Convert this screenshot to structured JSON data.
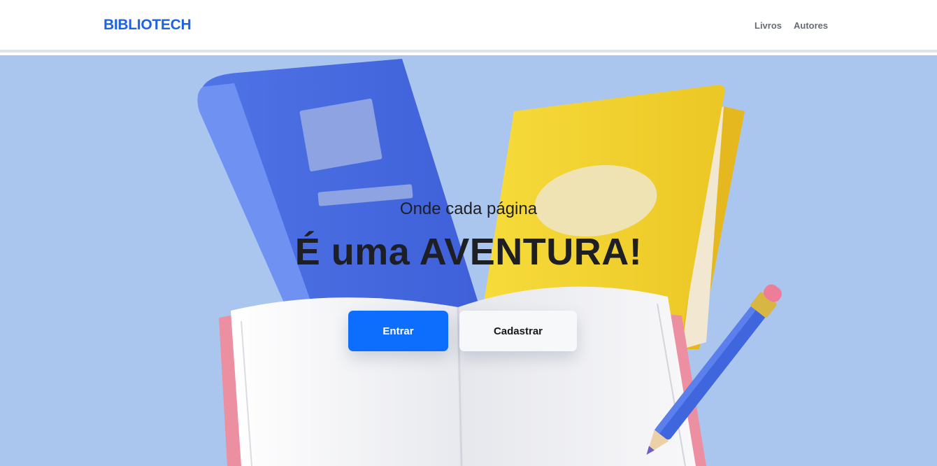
{
  "brand": "BIBLIOTECH",
  "nav": [
    {
      "label": "Livros"
    },
    {
      "label": "Autores"
    }
  ],
  "hero": {
    "subtitle": "Onde cada página",
    "title": "É uma AVENTURA!",
    "primary_button": "Entrar",
    "secondary_button": "Cadastrar"
  },
  "colors": {
    "brand": "#1d63e6",
    "hero_background": "#abc6ee",
    "primary_button": "#0d6efd"
  }
}
